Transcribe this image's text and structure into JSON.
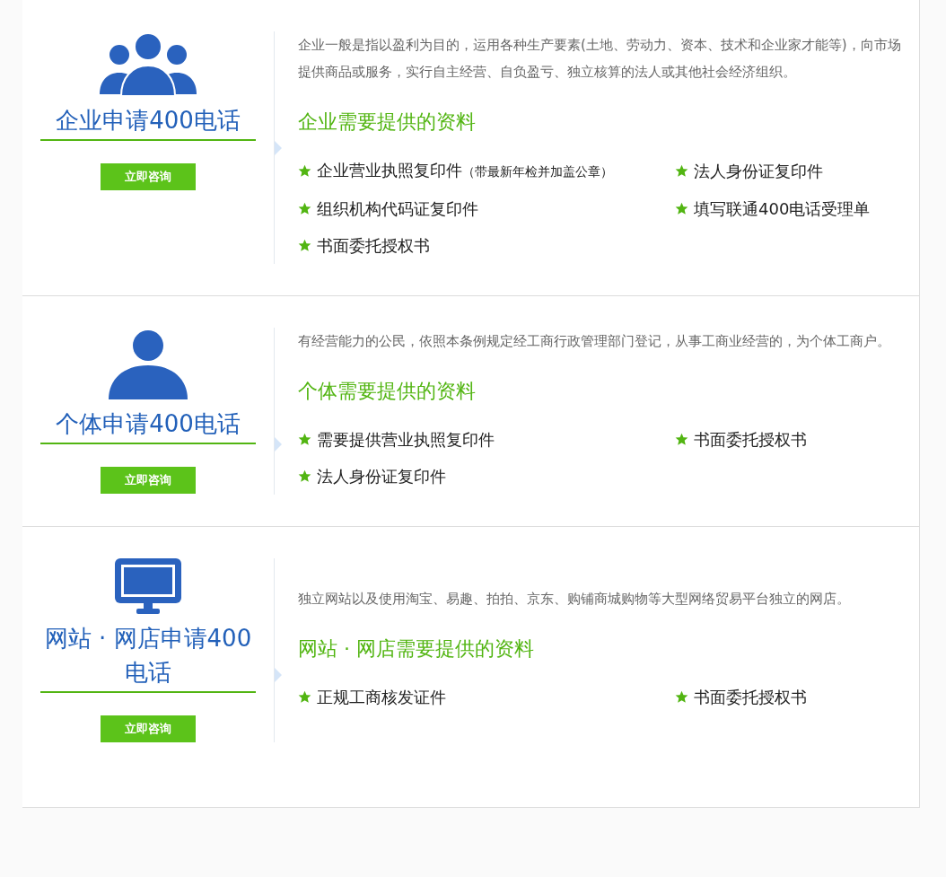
{
  "sections": [
    {
      "kind": "group",
      "title": "企业申请400电话",
      "button": "立即咨询",
      "description": "企业一般是指以盈利为目的，运用各种生产要素(土地、劳动力、资本、技术和企业家才能等)，向市场提供商品或服务，实行自主经营、自负盈亏、独立核算的法人或其他社会经济组织。",
      "heading": "企业需要提供的资料",
      "items": [
        {
          "text": "企业营业执照复印件",
          "note": "（带最新年检并加盖公章）"
        },
        {
          "text": "法人身份证复印件"
        },
        {
          "text": "组织机构代码证复印件"
        },
        {
          "text": "填写联通400电话受理单"
        },
        {
          "text": "书面委托授权书"
        }
      ]
    },
    {
      "kind": "individual",
      "title": "个体申请400电话",
      "button": "立即咨询",
      "description": "有经营能力的公民，依照本条例规定经工商行政管理部门登记，从事工商业经营的，为个体工商户。",
      "heading": "个体需要提供的资料",
      "items": [
        {
          "text": "需要提供营业执照复印件"
        },
        {
          "text": "书面委托授权书"
        },
        {
          "text": "法人身份证复印件"
        }
      ]
    },
    {
      "kind": "online",
      "title": "网站 · 网店申请400电话",
      "button": "立即咨询",
      "description": "独立网站以及使用淘宝、易趣、拍拍、京东、购铺商城购物等大型网络贸易平台独立的网店。",
      "heading": "网站 · 网店需要提供的资料",
      "items": [
        {
          "text": "正规工商核发证件"
        },
        {
          "text": "书面委托授权书"
        }
      ]
    }
  ]
}
